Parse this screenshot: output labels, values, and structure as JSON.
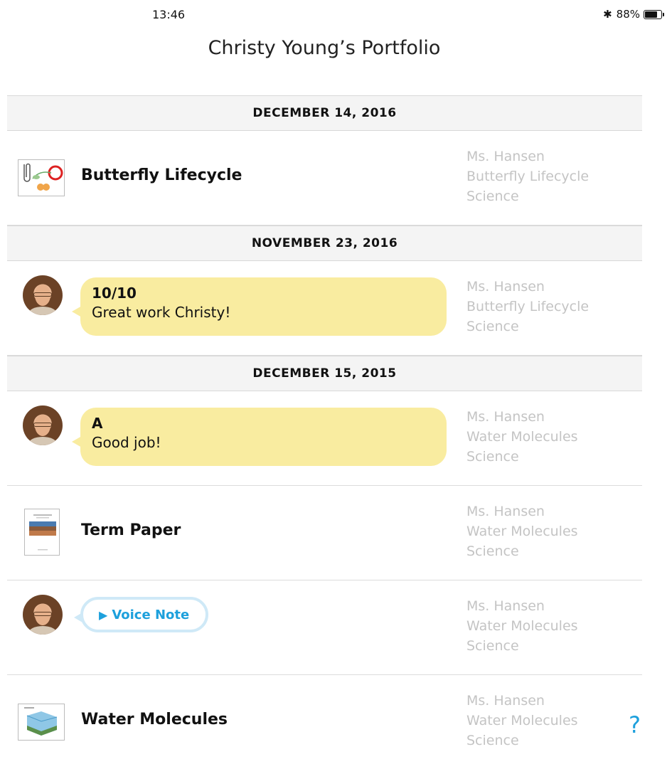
{
  "status_bar": {
    "time": "13:46",
    "bluetooth": "bluetooth-icon",
    "battery_percent": "88%",
    "battery_level": 0.88
  },
  "header": {
    "title": "Christy Young’s Portfolio"
  },
  "sections": [
    {
      "date": "DECEMBER 14, 2016",
      "items": [
        {
          "type": "file",
          "thumb": "diagram-thumbnail",
          "title": "Butterfly Lifecycle",
          "teacher": "Ms. Hansen",
          "assignment": "Butterfly Lifecycle",
          "subject": "Science"
        }
      ]
    },
    {
      "date": "NOVEMBER 23, 2016",
      "items": [
        {
          "type": "comment",
          "grade": "10/10",
          "comment": "Great work Christy!",
          "teacher": "Ms. Hansen",
          "assignment": "Butterfly Lifecycle",
          "subject": "Science"
        }
      ]
    },
    {
      "date": "DECEMBER 15, 2015",
      "items": [
        {
          "type": "comment",
          "grade": "A",
          "comment": "Good job!",
          "teacher": "Ms. Hansen",
          "assignment": "Water Molecules",
          "subject": "Science"
        },
        {
          "type": "file",
          "thumb": "paper-thumbnail",
          "title": "Term Paper",
          "teacher": "Ms. Hansen",
          "assignment": "Water Molecules",
          "subject": "Science"
        },
        {
          "type": "voice",
          "label": "Voice Note",
          "teacher": "Ms. Hansen",
          "assignment": "Water Molecules",
          "subject": "Science"
        },
        {
          "type": "file",
          "thumb": "diagram-thumbnail",
          "title": "Water Molecules",
          "teacher": "Ms. Hansen",
          "assignment": "Water Molecules",
          "subject": "Science"
        }
      ]
    }
  ],
  "help": "?",
  "colors": {
    "bubble": "#f9eca0",
    "accent": "#1da0dc",
    "meta_text": "#c4c4c4",
    "header_bg": "#f4f4f4"
  }
}
